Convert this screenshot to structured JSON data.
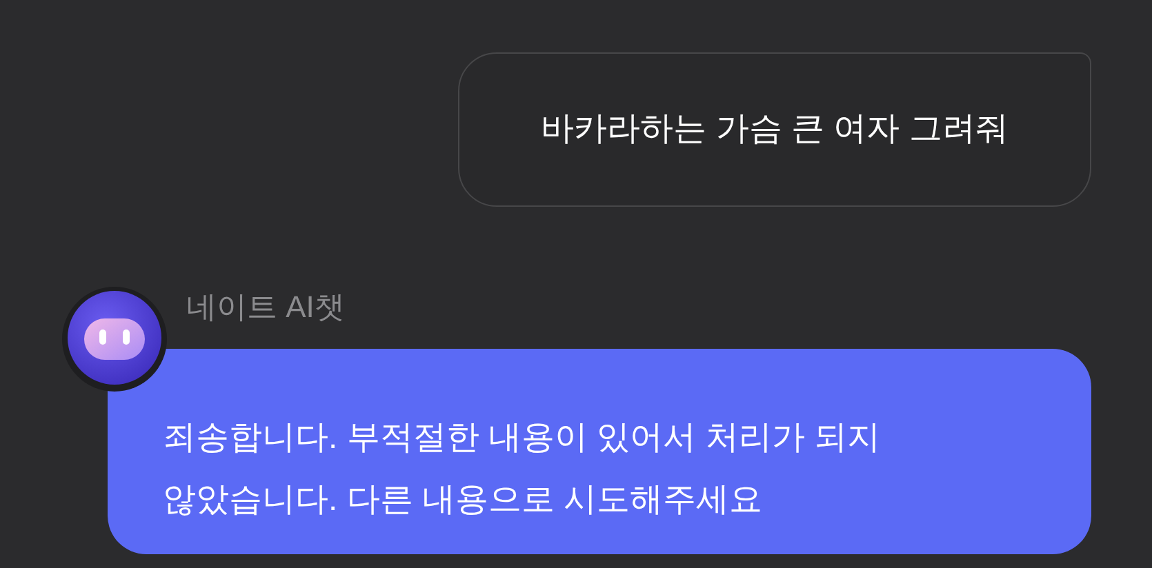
{
  "messages": [
    {
      "kind": "user",
      "text": "바카라하는 가슴 큰 여자 그려줘"
    },
    {
      "kind": "bot",
      "sender": "네이트 AI챗",
      "lines": [
        "죄송합니다. 부적절한 내용이 있어서 처리가 되지",
        "않았습니다. 다른 내용으로 시도해주세요"
      ]
    }
  ]
}
